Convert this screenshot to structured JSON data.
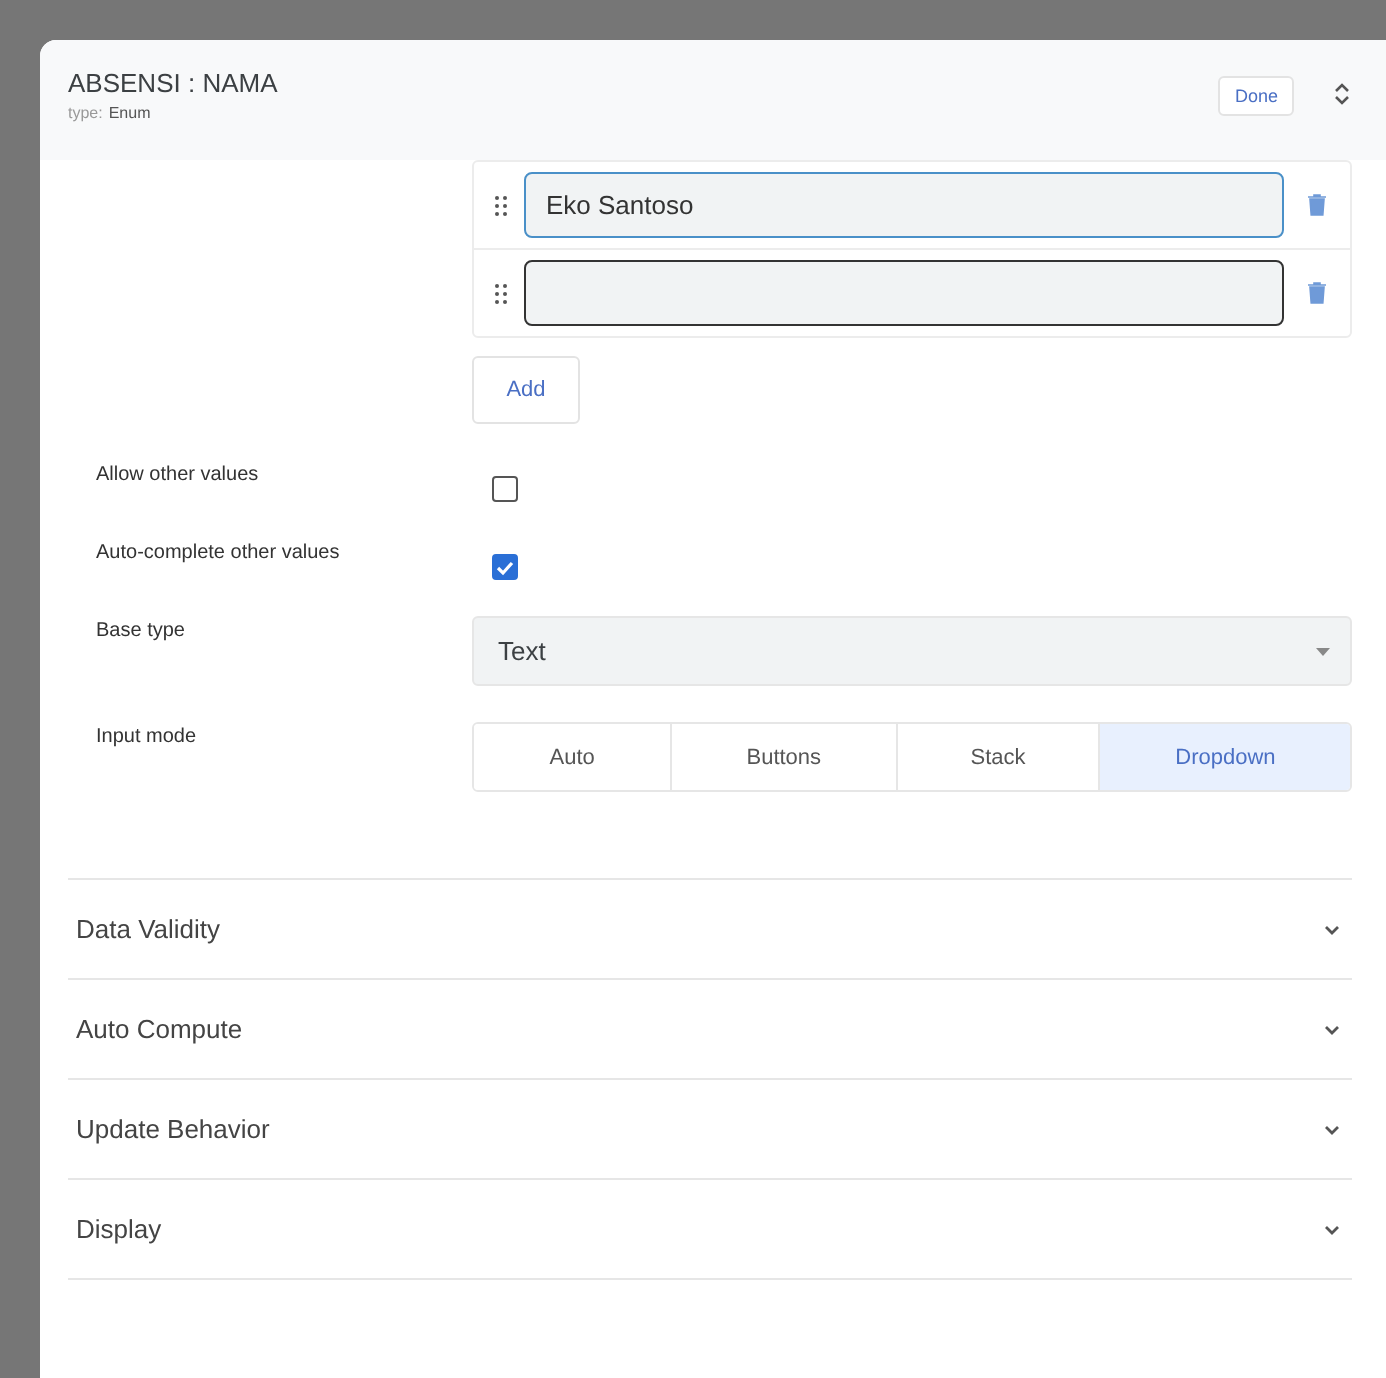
{
  "dialog": {
    "title": "ABSENSI : NAMA",
    "type_label": "type:",
    "type_value": "Enum",
    "done_button": "Done"
  },
  "values": [
    {
      "value": "Eko Santoso",
      "focused": true
    },
    {
      "focused": false
    }
  ],
  "add_button": "Add",
  "settings": [
    {
      "kind": "checkbox",
      "label": "Allow other values",
      "checked": false
    },
    {
      "kind": "checkbox",
      "label": "Auto-complete other values",
      "checked": true
    },
    {
      "kind": "select",
      "label": "Base type",
      "value": "Text"
    },
    {
      "kind": "segmented",
      "label": "Input mode",
      "options": [
        {
          "label": "Auto",
          "selected": false
        },
        {
          "label": "Buttons",
          "selected": false
        },
        {
          "label": "Stack",
          "selected": false
        },
        {
          "label": "Dropdown",
          "selected": true
        }
      ]
    }
  ],
  "sections": [
    {
      "title": "Data Validity",
      "expanded": false
    },
    {
      "title": "Auto Compute",
      "expanded": false
    },
    {
      "title": "Update Behavior",
      "expanded": false
    },
    {
      "title": "Display",
      "expanded": false
    }
  ]
}
